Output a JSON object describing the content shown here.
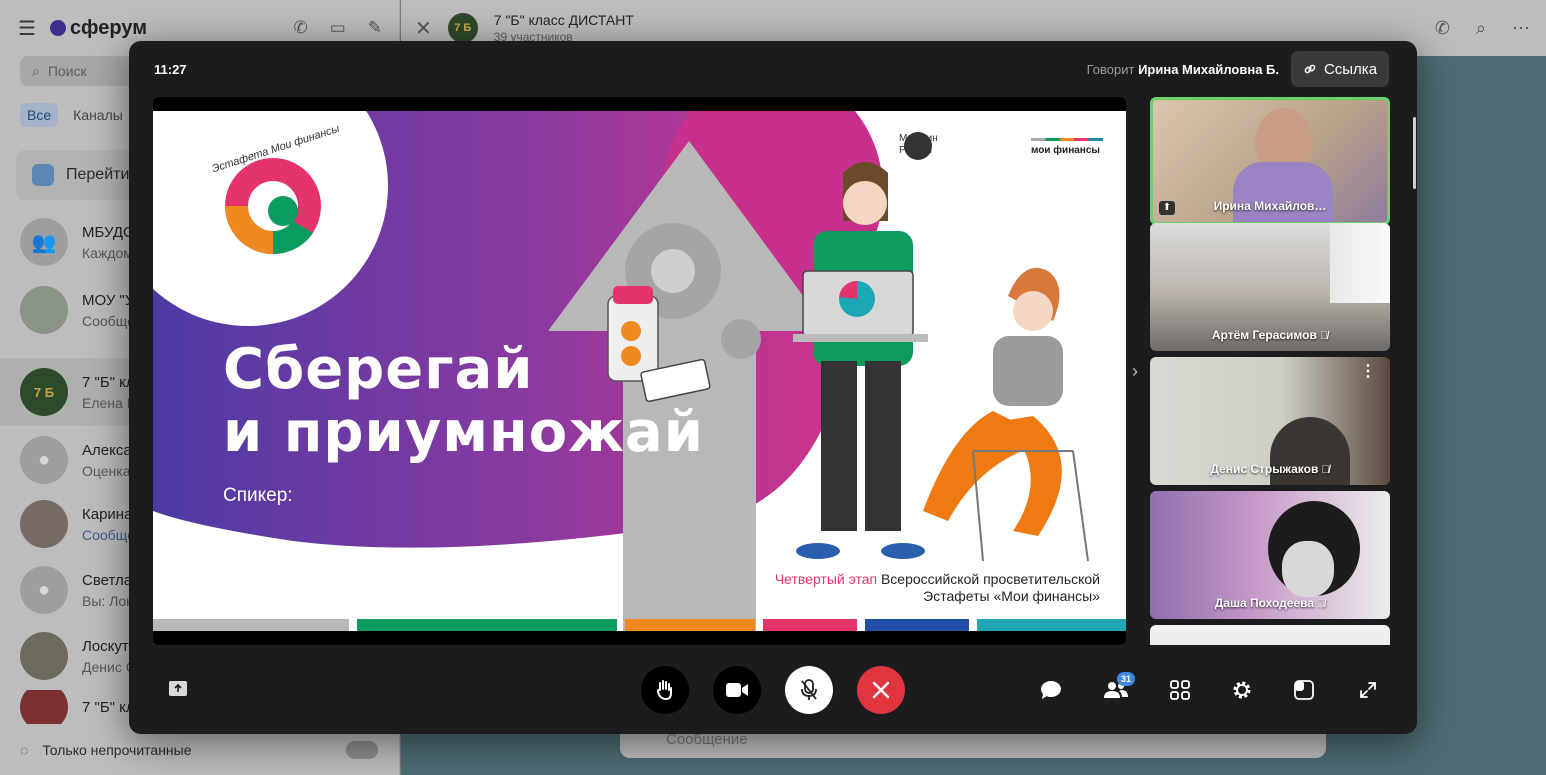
{
  "background_app": {
    "logo": "сферум",
    "search_placeholder": "Поиск",
    "tabs": [
      "Все",
      "Каналы"
    ],
    "goto_label": "Перейти",
    "chats": [
      {
        "title": "МБУДО",
        "subtitle": "Каждом"
      },
      {
        "title": "МОУ \"У",
        "subtitle": "Сообще"
      },
      {
        "title": "7 \"Б\" кл",
        "subtitle": "Елена Г"
      },
      {
        "title": "Алекса",
        "subtitle": "Оценка"
      },
      {
        "title": "Карина",
        "subtitle": "Сообще"
      },
      {
        "title": "Светла",
        "subtitle": "Вы: Лок"
      },
      {
        "title": "Лоскут",
        "subtitle": "Денис С"
      },
      {
        "title": "7 \"Б\" кл",
        "subtitle": ""
      }
    ],
    "unread_only_label": "Только непрочитанные",
    "chat_header": {
      "title": "7 \"Б\" класс ДИСТАНТ",
      "subtitle": "39 участников",
      "avatar_text": "7 Б"
    },
    "message_placeholder": "Сообщение"
  },
  "call": {
    "time": "11:27",
    "speaking_prefix": "Говорит",
    "speaking_name": "Ирина Михайловна Б.",
    "link_label": "Ссылка",
    "participants_count": "31"
  },
  "slide": {
    "title_line1": "Сберегай",
    "title_line2": "и приумножай",
    "speaker_label": "Спикер:",
    "footer_highlight": "Четвертый этап",
    "footer_rest": " Всероссийской просветительской",
    "footer_line2": "Эстафеты «Мои финансы»",
    "ministry_line1": "Минфин",
    "ministry_line2": "России",
    "brand": "мои финансы",
    "circle_text": "Эстафета Мои финансы"
  },
  "participants": [
    {
      "name": "Ирина Михайлов…",
      "muted": false,
      "active": true
    },
    {
      "name": "Артём Герасимов",
      "muted": true,
      "active": false
    },
    {
      "name": "Денис Стрыжаков",
      "muted": true,
      "active": false
    },
    {
      "name": "Даша Походеева",
      "muted": true,
      "active": false
    }
  ],
  "colors": {
    "accent_green": "#6bd16b",
    "end_call_red": "#e0343f",
    "badge_blue": "#3f8ae0",
    "slide_purple": "#5a3ea5",
    "slide_magenta": "#c43a8e"
  }
}
